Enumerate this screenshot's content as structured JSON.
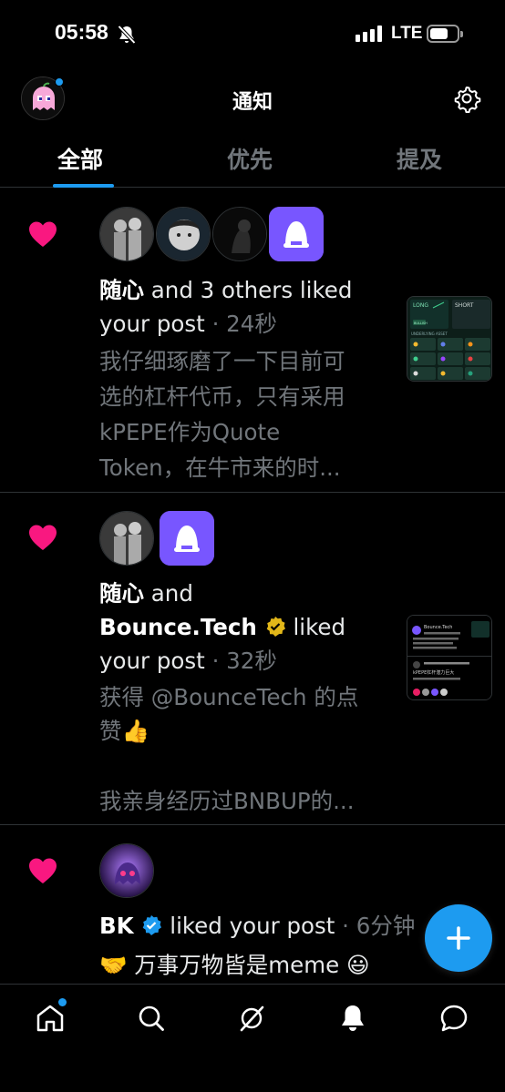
{
  "status_bar": {
    "time": "05:58",
    "network": "LTE"
  },
  "header": {
    "title": "通知"
  },
  "tabs": [
    {
      "label": "全部",
      "active": true
    },
    {
      "label": "优先",
      "active": false
    },
    {
      "label": "提及",
      "active": false
    }
  ],
  "notifications": [
    {
      "type": "like",
      "actor": "随心",
      "actor_suffix": " and 3 others liked",
      "action_line2": "your post",
      "time": "24秒",
      "snippet": [
        "我仔细琢磨了一下目前可",
        "选的杠杆代币，只有采用",
        "kPEPE作为Quote",
        "Token，在牛市来的时..."
      ],
      "preview": {
        "long_label": "LONG",
        "short_label": "SHORT",
        "tag": "BULLISH",
        "section": "UNDERLYING ASSET"
      }
    },
    {
      "type": "like",
      "actor": "随心",
      "actor_suffix": " and",
      "actor2": "Bounce.Tech",
      "actor2_suffix": " liked",
      "action_line3": "your post",
      "time": "32秒",
      "snippet": [
        "获得 @BounceTech 的点",
        "赞👍",
        "",
        "我亲身经历过BNBUP的..."
      ],
      "preview": {
        "name": "Bounce.Tech",
        "text": "kPEPE杠杆潜力巨大"
      }
    },
    {
      "type": "like",
      "actor": "BK",
      "action": " liked your post",
      "time": "6分钟",
      "snippet": [
        "🤝 万事万物皆是meme 😃"
      ]
    }
  ],
  "colors": {
    "accent": "#1d9bf0",
    "like": "#f91880",
    "background": "#000000",
    "muted": "#71767b"
  },
  "icons": [
    "home-icon",
    "search-icon",
    "grok-icon",
    "notifications-icon",
    "messages-icon",
    "compose-plus-icon",
    "settings-gear-icon"
  ]
}
